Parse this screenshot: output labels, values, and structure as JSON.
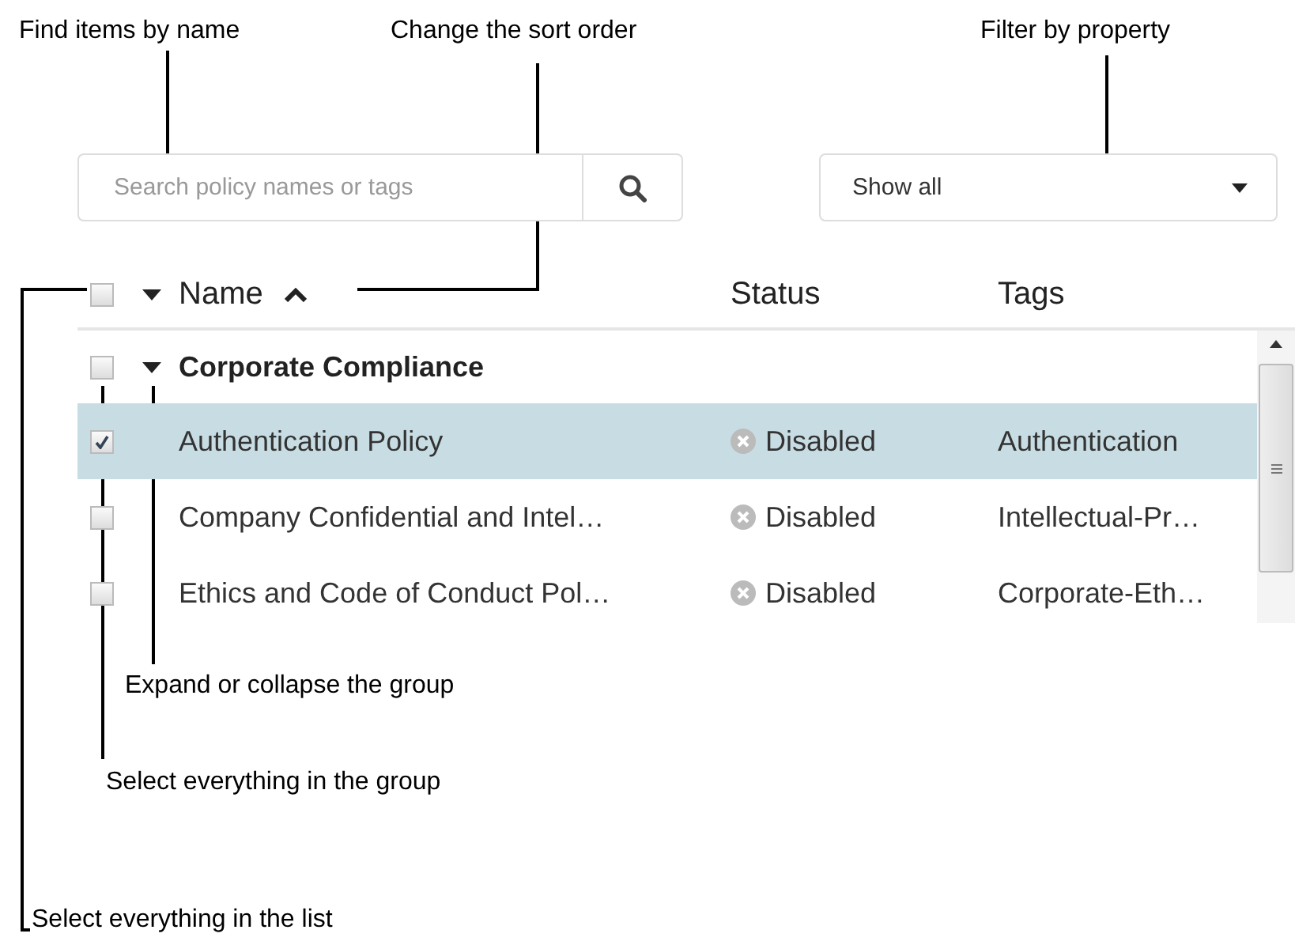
{
  "callouts": [
    {
      "text": "Find items by name"
    },
    {
      "text": "Change the sort order"
    },
    {
      "text": "Filter by property"
    },
    {
      "text": "Expand or collapse the group"
    },
    {
      "text": "Select everything in the group"
    },
    {
      "text": "Select everything in the list"
    }
  ],
  "search": {
    "placeholder": "Search policy names or tags"
  },
  "filter": {
    "value": "Show all"
  },
  "table": {
    "select_all_checked": false,
    "columns": [
      {
        "label": "Name",
        "sorted": true
      },
      {
        "label": "Status",
        "sorted": false
      },
      {
        "label": "Tags",
        "sorted": false
      }
    ],
    "group": {
      "name": "Corporate Compliance",
      "expanded": true,
      "checked": false
    },
    "rows": [
      {
        "name": "Authentication Policy",
        "status": "Disabled",
        "tags": "Authentication",
        "selected": true,
        "checked": true
      },
      {
        "name": "Company Confidential and Intel…",
        "status": "Disabled",
        "tags": "Intellectual-Pr…",
        "selected": false,
        "checked": false
      },
      {
        "name": "Ethics and Code of Conduct Pol…",
        "status": "Disabled",
        "tags": "Corporate-Eth…",
        "selected": false,
        "checked": false
      }
    ]
  }
}
